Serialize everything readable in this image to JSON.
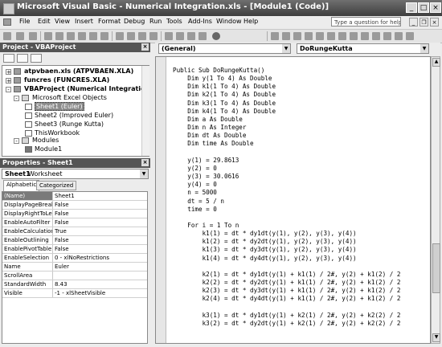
{
  "window": {
    "title": "Microsoft Visual Basic - Numerical Integration.xls - [Module1 (Code)]"
  },
  "menu": [
    "File",
    "Edit",
    "View",
    "Insert",
    "Format",
    "Debug",
    "Run",
    "Tools",
    "Add-Ins",
    "Window",
    "Help"
  ],
  "help_box": {
    "placeholder": "Type a question for help"
  },
  "project_pane": {
    "title": "Project - VBAProject",
    "tree": [
      {
        "label": "atpvbaen.xls (ATPVBAEN.XLA)",
        "bold": true,
        "level": 0,
        "toggle": "+"
      },
      {
        "label": "funcres (FUNCRES.XLA)",
        "bold": true,
        "level": 0,
        "toggle": "+"
      },
      {
        "label": "VBAProject (Numerical Integration.xls)",
        "bold": true,
        "level": 0,
        "toggle": "-"
      },
      {
        "label": "Microsoft Excel Objects",
        "level": 1,
        "toggle": "-"
      },
      {
        "label": "Sheet1 (Euler)",
        "level": 2,
        "selected": true
      },
      {
        "label": "Sheet2 (Improved Euler)",
        "level": 2
      },
      {
        "label": "Sheet3 (Runge Kutta)",
        "level": 2
      },
      {
        "label": "ThisWorkbook",
        "level": 2
      },
      {
        "label": "Modules",
        "level": 1,
        "toggle": "-"
      },
      {
        "label": "Module1",
        "level": 2
      }
    ]
  },
  "properties_pane": {
    "title": "Properties - Sheet1",
    "object_name": "Sheet1",
    "object_type": "Worksheet",
    "tabs": [
      "Alphabetic",
      "Categorized"
    ],
    "rows": [
      {
        "name": "(Name)",
        "value": "Sheet1"
      },
      {
        "name": "DisplayPageBreaks",
        "value": "False"
      },
      {
        "name": "DisplayRightToLeft",
        "value": "False"
      },
      {
        "name": "EnableAutoFilter",
        "value": "False"
      },
      {
        "name": "EnableCalculation",
        "value": "True"
      },
      {
        "name": "EnableOutlining",
        "value": "False"
      },
      {
        "name": "EnablePivotTable",
        "value": "False"
      },
      {
        "name": "EnableSelection",
        "value": "0 - xlNoRestrictions"
      },
      {
        "name": "Name",
        "value": "Euler"
      },
      {
        "name": "ScrollArea",
        "value": ""
      },
      {
        "name": "StandardWidth",
        "value": "8.43"
      },
      {
        "name": "Visible",
        "value": "-1 - xlSheetVisible"
      }
    ]
  },
  "code_window": {
    "object_combo": "(General)",
    "procedure_combo": "DoRungeKutta",
    "code": "Public Sub DoRungeKutta()\n    Dim y(1 To 4) As Double\n    Dim k1(1 To 4) As Double\n    Dim k2(1 To 4) As Double\n    Dim k3(1 To 4) As Double\n    Dim k4(1 To 4) As Double\n    Dim a As Double\n    Dim n As Integer\n    Dim dt As Double\n    Dim time As Double\n\n    y(1) = 29.8613\n    y(2) = 0\n    y(3) = 30.0616\n    y(4) = 0\n    n = 5000\n    dt = 5 / n\n    time = 0\n\n    For i = 1 To n\n        k1(1) = dt * dy1dt(y(1), y(2), y(3), y(4))\n        k1(2) = dt * dy2dt(y(1), y(2), y(3), y(4))\n        k1(3) = dt * dy3dt(y(1), y(2), y(3), y(4))\n        k1(4) = dt * dy4dt(y(1), y(2), y(3), y(4))\n\n        k2(1) = dt * dy1dt(y(1) + k1(1) / 2#, y(2) + k1(2) / 2\n        k2(2) = dt * dy2dt(y(1) + k1(1) / 2#, y(2) + k1(2) / 2\n        k2(3) = dt * dy3dt(y(1) + k1(1) / 2#, y(2) + k1(2) / 2\n        k2(4) = dt * dy4dt(y(1) + k1(1) / 2#, y(2) + k1(2) / 2\n\n        k3(1) = dt * dy1dt(y(1) + k2(1) / 2#, y(2) + k2(2) / 2\n        k3(2) = dt * dy2dt(y(1) + k2(1) / 2#, y(2) + k2(2) / 2"
  }
}
